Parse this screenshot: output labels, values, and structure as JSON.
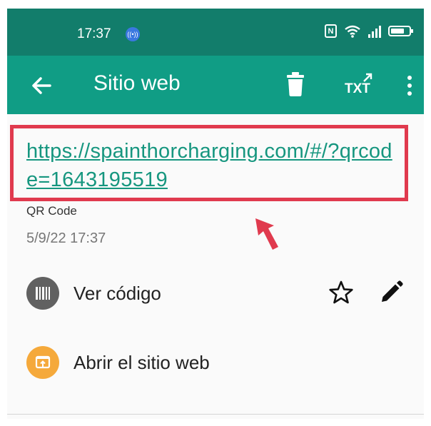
{
  "status_bar": {
    "time": "17:37",
    "notification_icon": "broadcast-icon",
    "nfc_label": "N",
    "icons": [
      "nfc-icon",
      "wifi-icon",
      "signal-icon",
      "battery-icon"
    ]
  },
  "app_bar": {
    "title": "Sitio web",
    "back_icon": "arrow-left-icon",
    "delete_icon": "trash-icon",
    "export_label": "TXT",
    "menu_icon": "more-vert-icon"
  },
  "content": {
    "url": "https://spainthorcharging.com/#/?qrcode=1643195519",
    "type": "QR Code",
    "date": "5/9/22 17:37"
  },
  "actions": {
    "view_code": {
      "label": "Ver código",
      "icon": "barcode-icon"
    },
    "favorite_icon": "star-outline-icon",
    "edit_icon": "pencil-icon",
    "open_site": {
      "label": "Abrir el sitio web",
      "icon": "open-in-browser-icon"
    }
  },
  "colors": {
    "status_bar": "#127d6b",
    "app_bar": "#109d85",
    "link": "#16967f",
    "highlight": "#e03a4e",
    "open_icon_bg": "#f5a93b"
  }
}
